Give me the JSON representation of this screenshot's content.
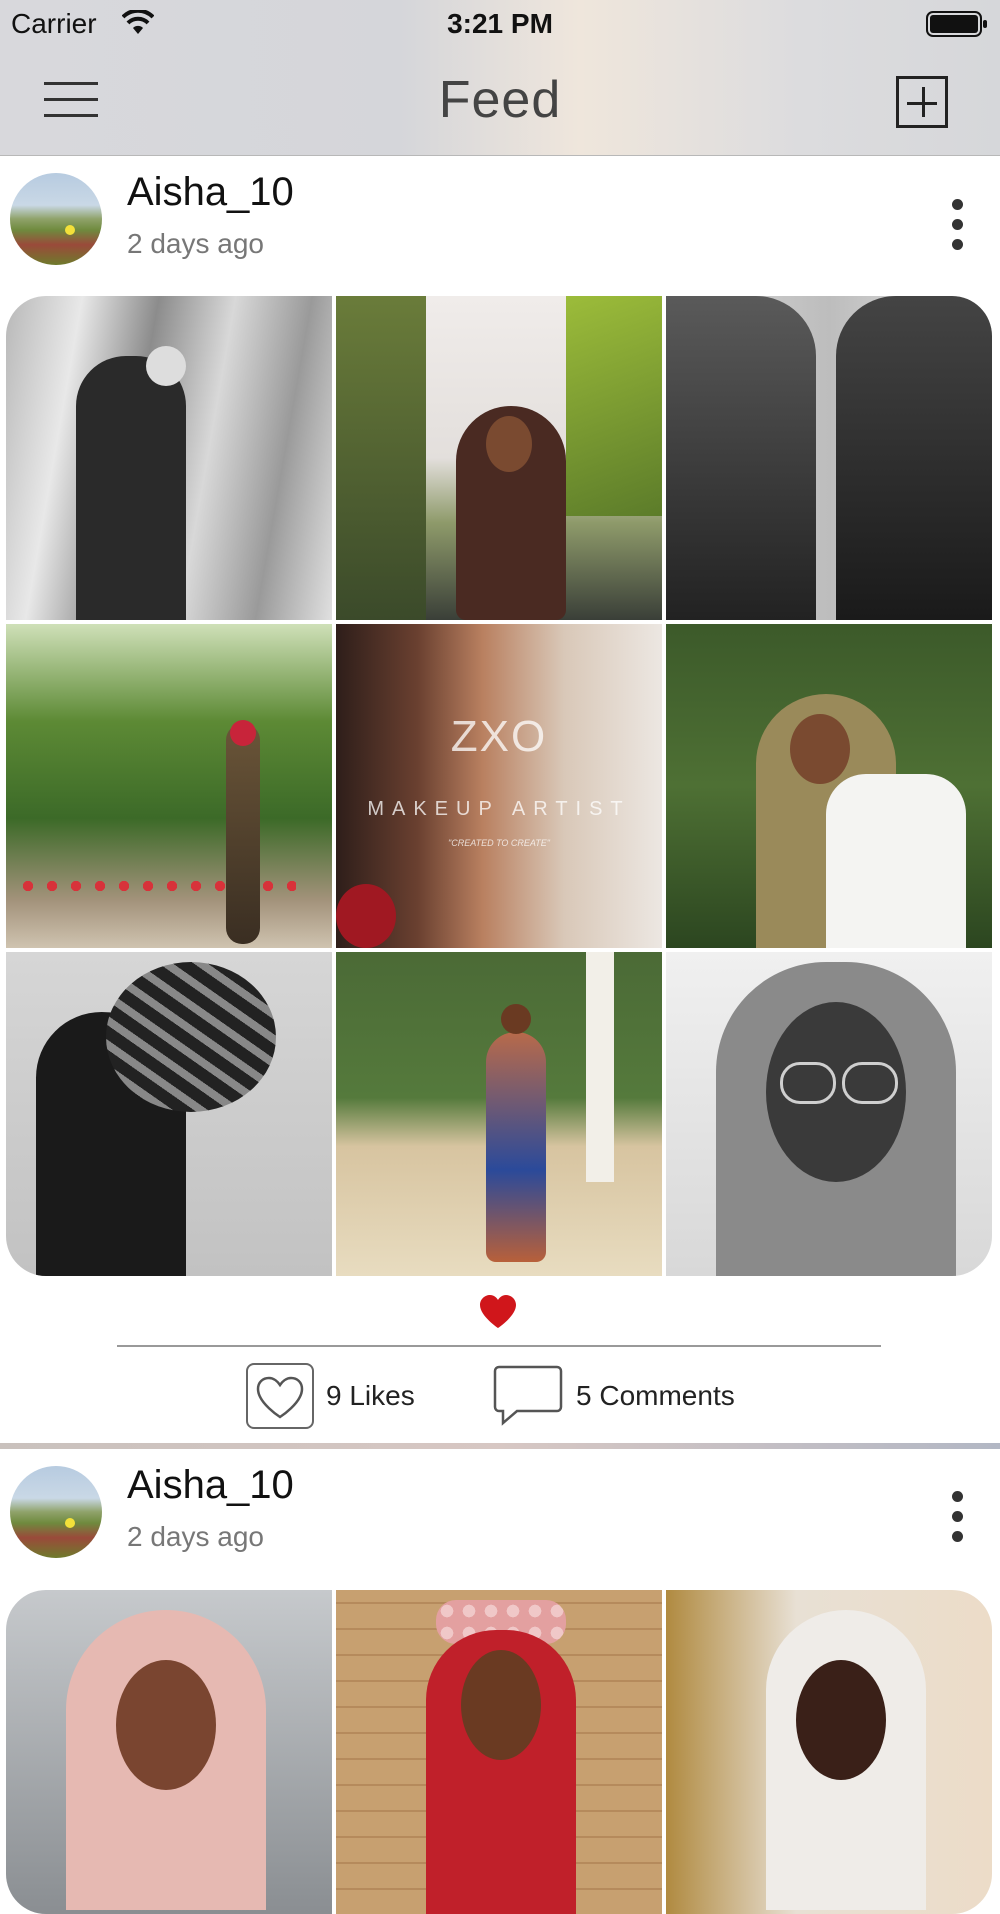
{
  "status_bar": {
    "carrier": "Carrier",
    "time": "3:21 PM"
  },
  "header": {
    "title": "Feed",
    "menu_icon": "hamburger-menu-icon",
    "add_icon": "plus-square-icon"
  },
  "posts": [
    {
      "username": "Aisha_10",
      "time_ago": "2 days ago",
      "photos": [
        {
          "description_icon": "photo"
        },
        {
          "description_icon": "photo"
        },
        {
          "description_icon": "photo"
        },
        {
          "description_icon": "photo"
        },
        {
          "description_icon": "photo",
          "watermark_logo": "ZXO",
          "watermark_line": "MAKEUP ARTIST",
          "watermark_tag": "\"CREATED TO CREATE\""
        },
        {
          "description_icon": "photo"
        },
        {
          "description_icon": "photo"
        },
        {
          "description_icon": "photo"
        },
        {
          "description_icon": "photo"
        }
      ],
      "likes_label": "9 Likes",
      "comments_label": "5 Comments",
      "liked": true
    },
    {
      "username": "Aisha_10",
      "time_ago": "2 days ago"
    }
  ],
  "colors": {
    "heart": "#d0161b",
    "header_bg": "#dcdcdf",
    "divider": "#999999"
  }
}
